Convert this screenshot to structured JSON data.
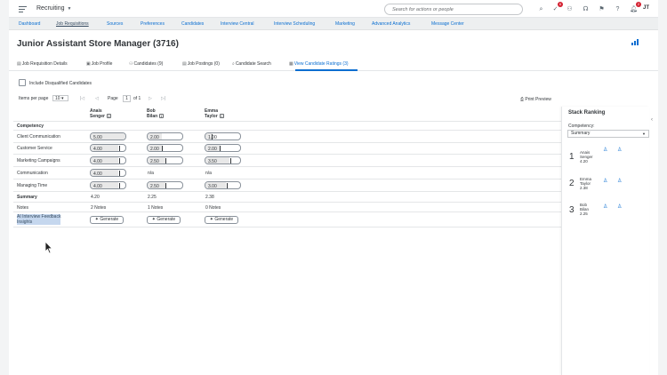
{
  "topbar": {
    "module": "Recruiting",
    "search_placeholder": "Search for actions or people",
    "badge_1": "6",
    "badge_2": "2",
    "user_initials": "JT"
  },
  "nav": [
    "Dashboard",
    "Job Requisitions",
    "Sources",
    "Preferences",
    "Candidates",
    "Interview Central",
    "Interview Scheduling",
    "Marketing",
    "Advanced Analytics",
    "Message Center"
  ],
  "page": {
    "title": "Junior Assistant Store Manager (3716)"
  },
  "tabs": [
    "Job Requisition Details",
    "Job Profile",
    "Candidates (9)",
    "Job Postings (0)",
    "Candidate Search",
    "View Candidate Ratings (3)"
  ],
  "filters": {
    "include_disqualified": "Include Disqualified Candidates",
    "items_per_page_label": "Items per page",
    "items_per_page_value": "10",
    "page_label": "Page",
    "page_value": "1",
    "of_label": "of 1",
    "print_preview": "Print Preview"
  },
  "table": {
    "candidates": [
      {
        "first": "Anais",
        "last": "Senger"
      },
      {
        "first": "Bob",
        "last": "Bilan"
      },
      {
        "first": "Emma",
        "last": "Taylor"
      }
    ],
    "competency_header": "Competency",
    "rows": [
      {
        "label": "Client Communication",
        "values": [
          "5.00",
          "2.00",
          "1.00"
        ]
      },
      {
        "label": "Customer Service",
        "values": [
          "4.00",
          "2.00",
          "2.00"
        ]
      },
      {
        "label": "Marketing Campaigns",
        "values": [
          "4.00",
          "2.50",
          "3.50"
        ]
      },
      {
        "label": "Communication",
        "values": [
          "4.00",
          "n/a",
          "n/a"
        ]
      },
      {
        "label": "Managing Time",
        "values": [
          "4.00",
          "2.50",
          "3.00"
        ]
      }
    ],
    "summary_label": "Summary",
    "summary_values": [
      "4.20",
      "2.25",
      "2.38"
    ],
    "notes_label": "Notes",
    "notes_values": [
      "2 Notes",
      "1 Notes",
      "0 Notes"
    ],
    "ai_label_line1": "AI Interview Feedback",
    "ai_label_line2": "Insights",
    "generate_label": "Generate"
  },
  "stack": {
    "title": "Stack Ranking",
    "competency_label": "Competency:",
    "competency_value": "Summary",
    "ranks": [
      {
        "num": "1",
        "first": "Anais",
        "last": "Senger",
        "score": "4.20"
      },
      {
        "num": "2",
        "first": "Emma",
        "last": "Taylor",
        "score": "2.38"
      },
      {
        "num": "3",
        "first": "Bob",
        "last": "Bilan",
        "score": "2.25"
      }
    ]
  },
  "colors": {
    "accent": "#0a6ed1",
    "selection": "#c5d7ee"
  }
}
